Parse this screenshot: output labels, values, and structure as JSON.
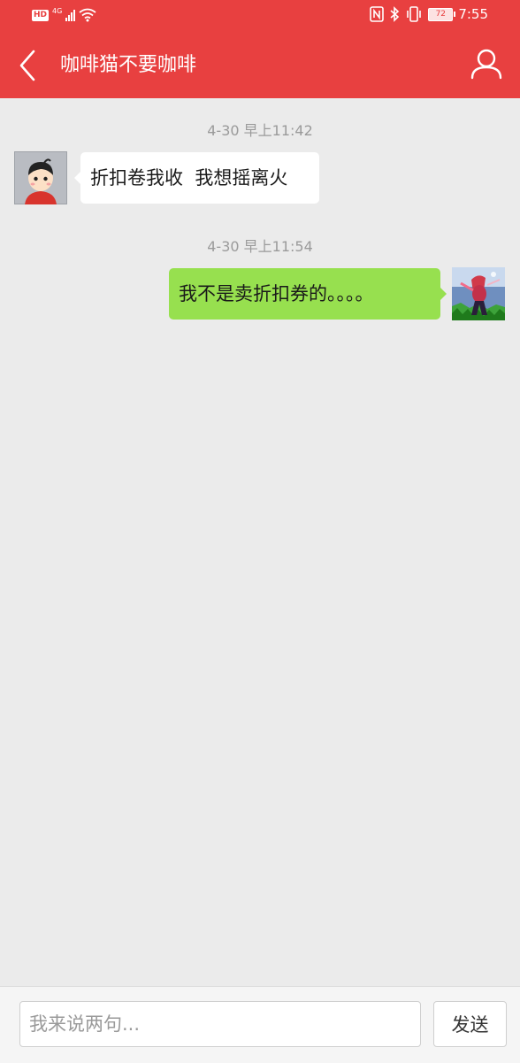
{
  "statusbar": {
    "hd_badge": "HD",
    "network": "4G",
    "battery": "72",
    "time": "7:55",
    "icons": [
      "signal-icon",
      "wifi-icon",
      "nfc-icon",
      "bluetooth-icon",
      "vibrate-icon",
      "battery-icon"
    ]
  },
  "header": {
    "title": "咖啡猫不要咖啡",
    "back_icon": "back-icon",
    "profile_icon": "profile-icon",
    "color": "#e84040"
  },
  "messages": [
    {
      "time": "4-30 早上11:42",
      "sender": "other",
      "text": "折扣卷我收  我想摇离火"
    },
    {
      "time": "4-30 早上11:54",
      "sender": "me",
      "text": "我不是卖折扣券的。。。。"
    }
  ],
  "composer": {
    "placeholder": "我来说两句...",
    "value": "",
    "send_label": "发送"
  },
  "colors": {
    "background": "#ebebeb",
    "my_bubble": "#97e04f",
    "other_bubble": "#ffffff"
  }
}
